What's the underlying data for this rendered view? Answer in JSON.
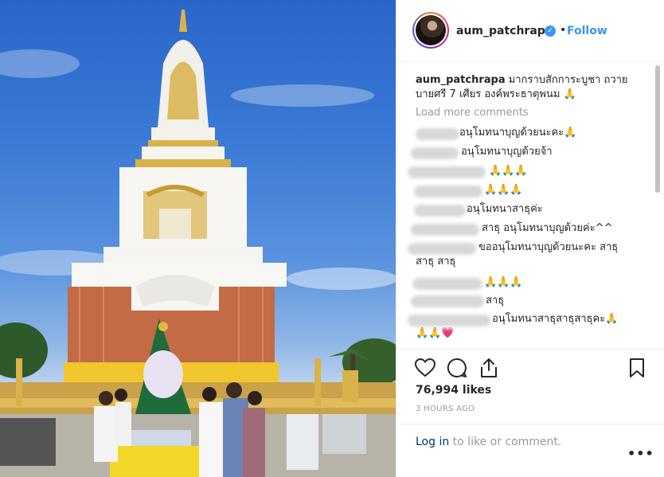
{
  "post": {
    "username": "aum_patchrapa",
    "follow_label": "Follow",
    "caption_user": "aum_patchrapa",
    "caption_line1": " มากราบสักการะบูชา ถวาย",
    "caption_line2": "บายศรี 7 เศียร องค์พระธาตุพนม 🙏",
    "load_more": "Load more comments",
    "likes": "76,994 likes",
    "time": "3 HOURS AGO",
    "login_link": "Log in",
    "login_rest": " to like or comment.",
    "more": "•••"
  },
  "comments": [
    {
      "text": "อนุโมทนาบุญด้วยนะคะ🙏"
    },
    {
      "text": "อนุโมทนาบุญด้วยจ้า"
    },
    {
      "text": "🙏🙏🙏"
    },
    {
      "text": "🙏🙏🙏"
    },
    {
      "text": "อนุโมทนาสาธุค่ะ"
    },
    {
      "text": "สาธุ อนุโมทนาบุญด้วยค่ะ^^"
    },
    {
      "text": "ขออนุโมทนาบุญด้วยนะคะ สาธุ"
    },
    {
      "text": "สาธุ สาธุ"
    },
    {
      "text": "🙏🙏🙏"
    },
    {
      "text": "สาธุ"
    },
    {
      "text": "อนุโมทนาสาธุสาธุสาธุคะ🙏"
    },
    {
      "text": "🙏🙏💗"
    }
  ],
  "colors": {
    "accent": "#3897f0",
    "link": "#003569",
    "muted": "#999999",
    "text": "#262626"
  },
  "icons": [
    "verified-badge-icon",
    "heart-icon",
    "comment-icon",
    "share-icon",
    "bookmark-icon",
    "more-options-icon"
  ]
}
